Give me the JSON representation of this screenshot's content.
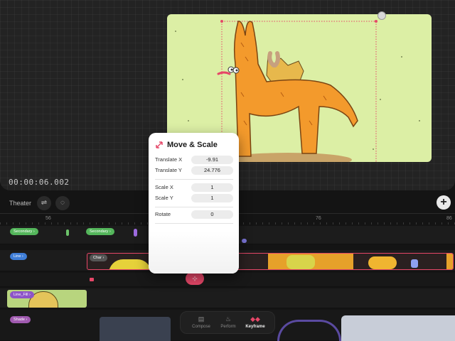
{
  "stage": {
    "timecode": "00:00:06.002"
  },
  "toolbar": {
    "theater_label": "Theater",
    "sliders_icon": "sliders-icon",
    "comment_icon": "speech-bubble-icon",
    "add_icon": "plus-icon"
  },
  "ruler": {
    "labels": [
      "56",
      "76",
      "86"
    ]
  },
  "tracks": {
    "secondary_tag_1": "Secondary",
    "secondary_tag_2": "Secondary",
    "line_tag": "Line",
    "char_tag": "Char",
    "line_fill_tag": "Line_Fill",
    "shade_tag": "Shade"
  },
  "panel": {
    "title": "Move & Scale",
    "rows": [
      {
        "label": "Translate X",
        "value": "-9.91"
      },
      {
        "label": "Translate Y",
        "value": "24.776"
      },
      {
        "label": "Scale X",
        "value": "1"
      },
      {
        "label": "Scale Y",
        "value": "1"
      },
      {
        "label": "Rotate",
        "value": "0"
      }
    ]
  },
  "bottom_nav": {
    "items": [
      {
        "label": "Compose",
        "icon": "compose-icon"
      },
      {
        "label": "Perform",
        "icon": "flame-icon"
      },
      {
        "label": "Keyframe",
        "icon": "keyframe-icon"
      }
    ],
    "active": "Keyframe"
  },
  "colors": {
    "accent": "#e64768",
    "canvas_bg": "#dcefa5",
    "character": "#f39a2c",
    "track_green": "#54b65b",
    "track_blue": "#3f7ed8",
    "track_purple": "#8d54c8"
  }
}
